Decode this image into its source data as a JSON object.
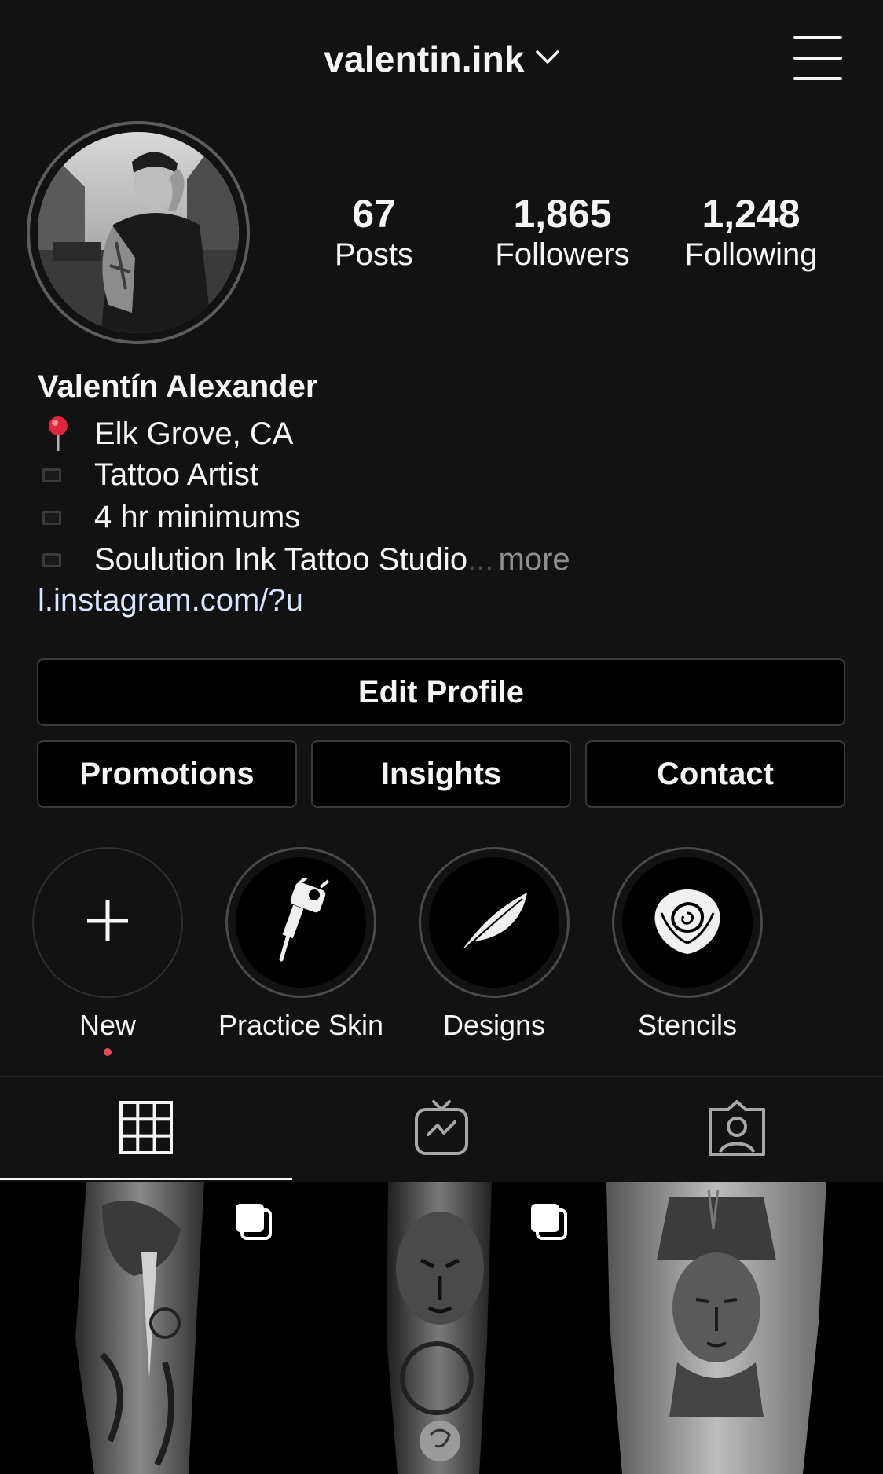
{
  "header": {
    "username": "valentin.ink"
  },
  "profile": {
    "stats": {
      "posts": {
        "value": "67",
        "label": "Posts"
      },
      "followers": {
        "value": "1,865",
        "label": "Followers"
      },
      "following": {
        "value": "1,248",
        "label": "Following"
      }
    },
    "full_name": "Valentín Alexander",
    "bio": [
      {
        "icon": "round-pushpin-emoji",
        "text": "Elk Grove, CA"
      },
      {
        "icon": "black-square-emoji",
        "text": "Tattoo Artist"
      },
      {
        "icon": "black-square-emoji",
        "text": "4 hr minimums"
      },
      {
        "icon": "black-square-emoji",
        "text": "Soulution Ink Tattoo Studio"
      }
    ],
    "bio_truncation": "...",
    "bio_more": "more",
    "link": "l.instagram.com/?u"
  },
  "buttons": {
    "edit_profile": "Edit Profile",
    "promotions": "Promotions",
    "insights": "Insights",
    "contact": "Contact"
  },
  "highlights": [
    {
      "label": "New",
      "icon": "plus-icon"
    },
    {
      "label": "Practice Skin",
      "icon": "tattoo-machine-icon"
    },
    {
      "label": "Designs",
      "icon": "feather-icon"
    },
    {
      "label": "Stencils",
      "icon": "rose-icon"
    }
  ],
  "tabs": [
    {
      "name": "grid",
      "icon": "grid-icon",
      "active": true
    },
    {
      "name": "igtv",
      "icon": "igtv-icon",
      "active": false
    },
    {
      "name": "tagged",
      "icon": "tagged-user-icon",
      "active": false
    }
  ],
  "posts": [
    {
      "subject": "wolf and dagger leg tattoo",
      "multiple": true
    },
    {
      "subject": "lion, clock and rose leg tattoo",
      "multiple": true
    },
    {
      "subject": "Nefertiti portrait leg tattoo",
      "multiple": false
    }
  ],
  "colors": {
    "background": "#121212",
    "text": "#f5f5f5",
    "muted": "#8e8e8e",
    "button_bg": "#000000",
    "button_border": "#3a3a3a",
    "notification_dot": "#ed4956"
  }
}
